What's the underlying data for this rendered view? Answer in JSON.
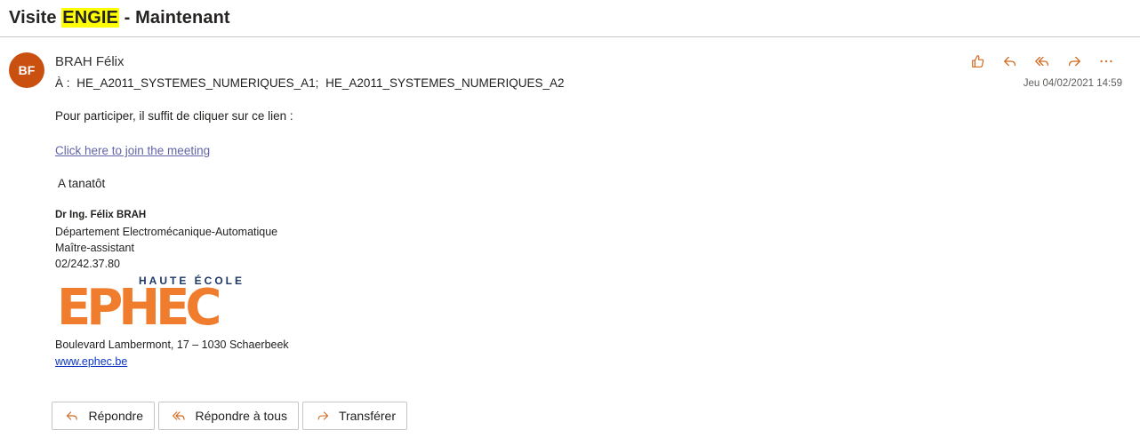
{
  "subject": {
    "prefix": "Visite ",
    "highlight": "ENGIE",
    "suffix": " - Maintenant"
  },
  "message": {
    "avatar_initials": "BF",
    "sender": "BRAH Félix",
    "to_label": "À :",
    "recipients": [
      "HE_A2011_SYSTEMES_NUMERIQUES_A1;",
      "HE_A2011_SYSTEMES_NUMERIQUES_A2"
    ],
    "date": "Jeu 04/02/2021 14:59",
    "action_icons": [
      "like-icon",
      "reply-icon",
      "reply-all-icon",
      "forward-icon",
      "more-icon"
    ]
  },
  "body": {
    "intro": "Pour participer, il suffit de cliquer sur ce lien :",
    "link": "Click here to join the meeting",
    "closing": "A tanatôt"
  },
  "signature": {
    "name": "Dr Ing. Félix BRAH",
    "department": "Département Electromécanique-Automatique",
    "role": "Maître-assistant",
    "phone": "02/242.37.80",
    "logo_subtitle": "HAUTE ÉCOLE",
    "logo_name": "EPHEC",
    "address": "Boulevard Lambermont, 17 – 1030 Schaerbeek",
    "website": "www.ephec.be"
  },
  "reply_buttons": {
    "reply": "Répondre",
    "reply_all": "Répondre à tous",
    "forward": "Transférer"
  },
  "colors": {
    "accent": "#ca5010",
    "icon": "#d2691e",
    "link": "#6264a7",
    "highlight": "#ffff00",
    "logo_orange": "#f07c2d",
    "logo_blue": "#1f3864"
  }
}
